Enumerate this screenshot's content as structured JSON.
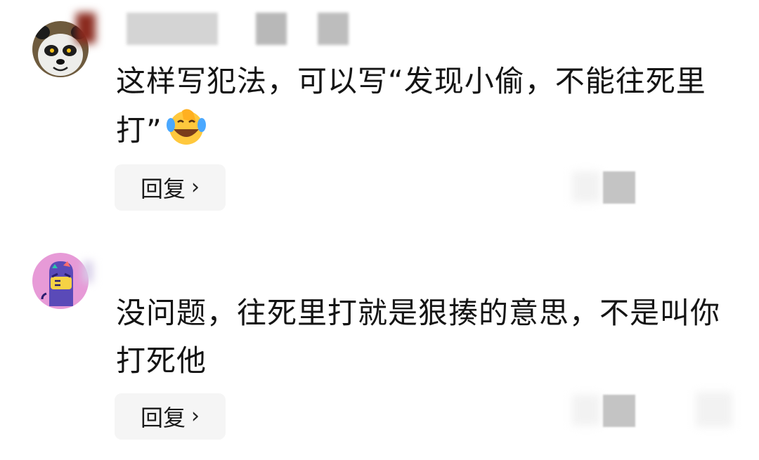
{
  "comments": [
    {
      "avatar": "panda-avatar",
      "text": "这样写犯法，可以写“发现小偷，不能往死里打”",
      "emoji": "laughing-crying-face-icon",
      "reply_label": "回复",
      "reply_icon": "chevron-right-icon"
    },
    {
      "avatar": "purple-monster-avatar",
      "text": "没问题，往死里打就是狠揍的意思，不是叫你打死他",
      "reply_label": "回复",
      "reply_icon": "chevron-right-icon"
    }
  ],
  "colors": {
    "reply_bg": "#f5f5f5",
    "text": "#141414",
    "blur_gray": "#c9c9c9"
  }
}
